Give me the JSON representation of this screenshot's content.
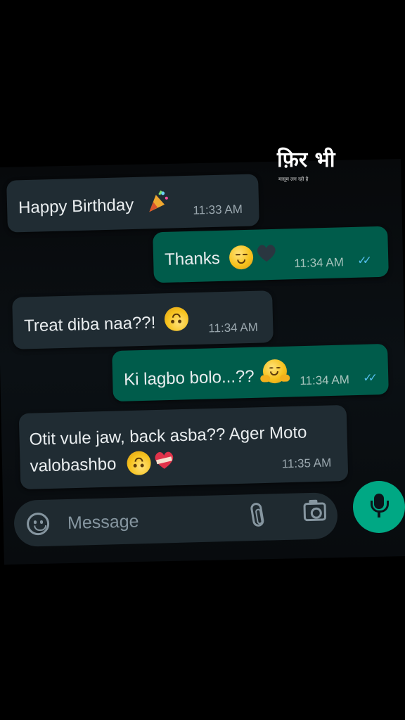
{
  "overlay": {
    "title": "फ़िर भी",
    "subtitle": "मासूम लग रही है"
  },
  "messages": [
    {
      "direction": "incoming",
      "text": "Happy Birthday",
      "emoji": "party-popper-icon",
      "time": "11:33 AM"
    },
    {
      "direction": "outgoing",
      "text": "Thanks",
      "emoji": "relieved-face-icon, black-heart-icon",
      "time": "11:34 AM",
      "read": true
    },
    {
      "direction": "incoming",
      "text": "Treat diba naa??!",
      "emoji": "upside-down-face-icon",
      "time": "11:34 AM"
    },
    {
      "direction": "outgoing",
      "text": "Ki lagbo bolo...??",
      "emoji": "hugging-face-icon",
      "time": "11:34 AM",
      "read": true
    },
    {
      "direction": "incoming",
      "text_line1": "Otit vule jaw, back asba?? Ager Moto",
      "text_line2": "valobashbo",
      "emoji": "upside-down-face-icon, mending-heart-icon",
      "time": "11:35 AM"
    }
  ],
  "composer": {
    "placeholder": "Message",
    "icons": [
      "sticker-icon",
      "attach-icon",
      "camera-icon",
      "mic-icon"
    ]
  },
  "colors": {
    "background": "#000000",
    "incoming_bubble": "#202c33",
    "outgoing_bubble": "#005c4b",
    "accent": "#00a884",
    "read_ticks": "#53bdeb"
  }
}
